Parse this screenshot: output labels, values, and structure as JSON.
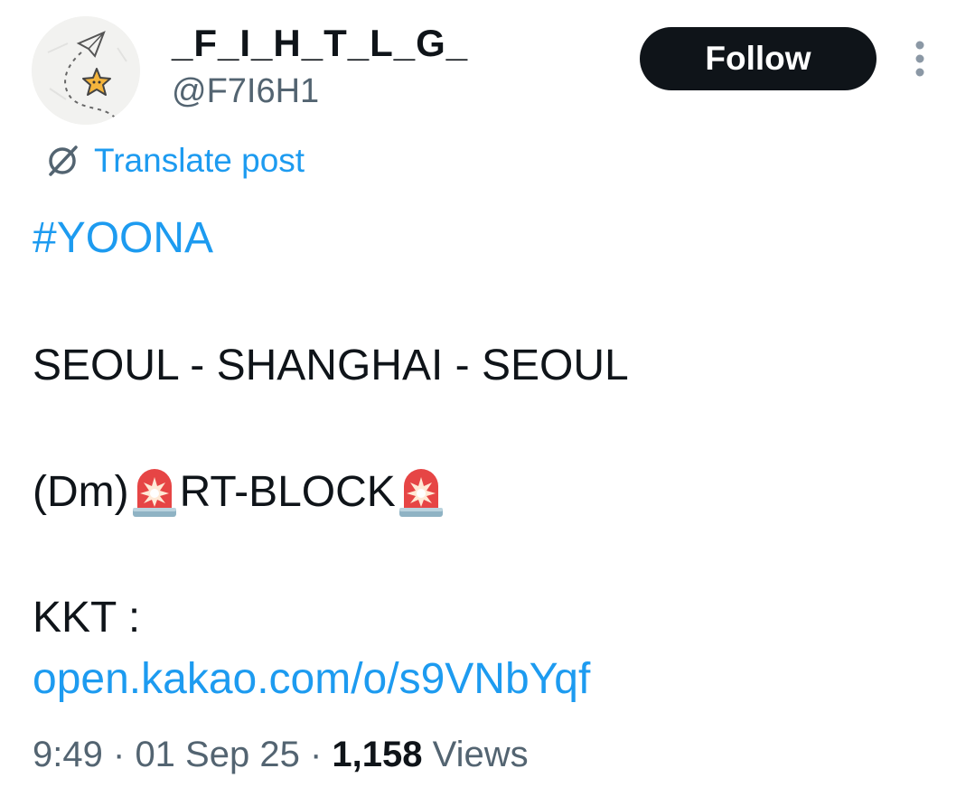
{
  "author": {
    "display_name": "_F_I_H_T_L_G_",
    "handle": "@F7I6H1",
    "avatar": "paper-plane-star-avatar"
  },
  "header": {
    "follow_label": "Follow",
    "more_icon": "more-vertical-icon"
  },
  "translate": {
    "label": "Translate post",
    "icon": "globe-slash-icon"
  },
  "post": {
    "hashtag": "#YOONA",
    "route": "SEOUL - SHANGHAI - SEOUL",
    "dm_prefix": "(Dm)",
    "dm_middle": "RT-BLOCK",
    "siren_icon": "police-light-emoji",
    "kkt_label": "KKT :",
    "kkt_link": "open.kakao.com/o/s9VNbYqf"
  },
  "meta": {
    "time": "9:49",
    "separator": "·",
    "date": "01 Sep 25",
    "views_count": "1,158",
    "views_label": "Views"
  },
  "colors": {
    "accent": "#1d9bf0",
    "text": "#0f1419",
    "secondary": "#536471",
    "follow_bg": "#0f1419"
  }
}
